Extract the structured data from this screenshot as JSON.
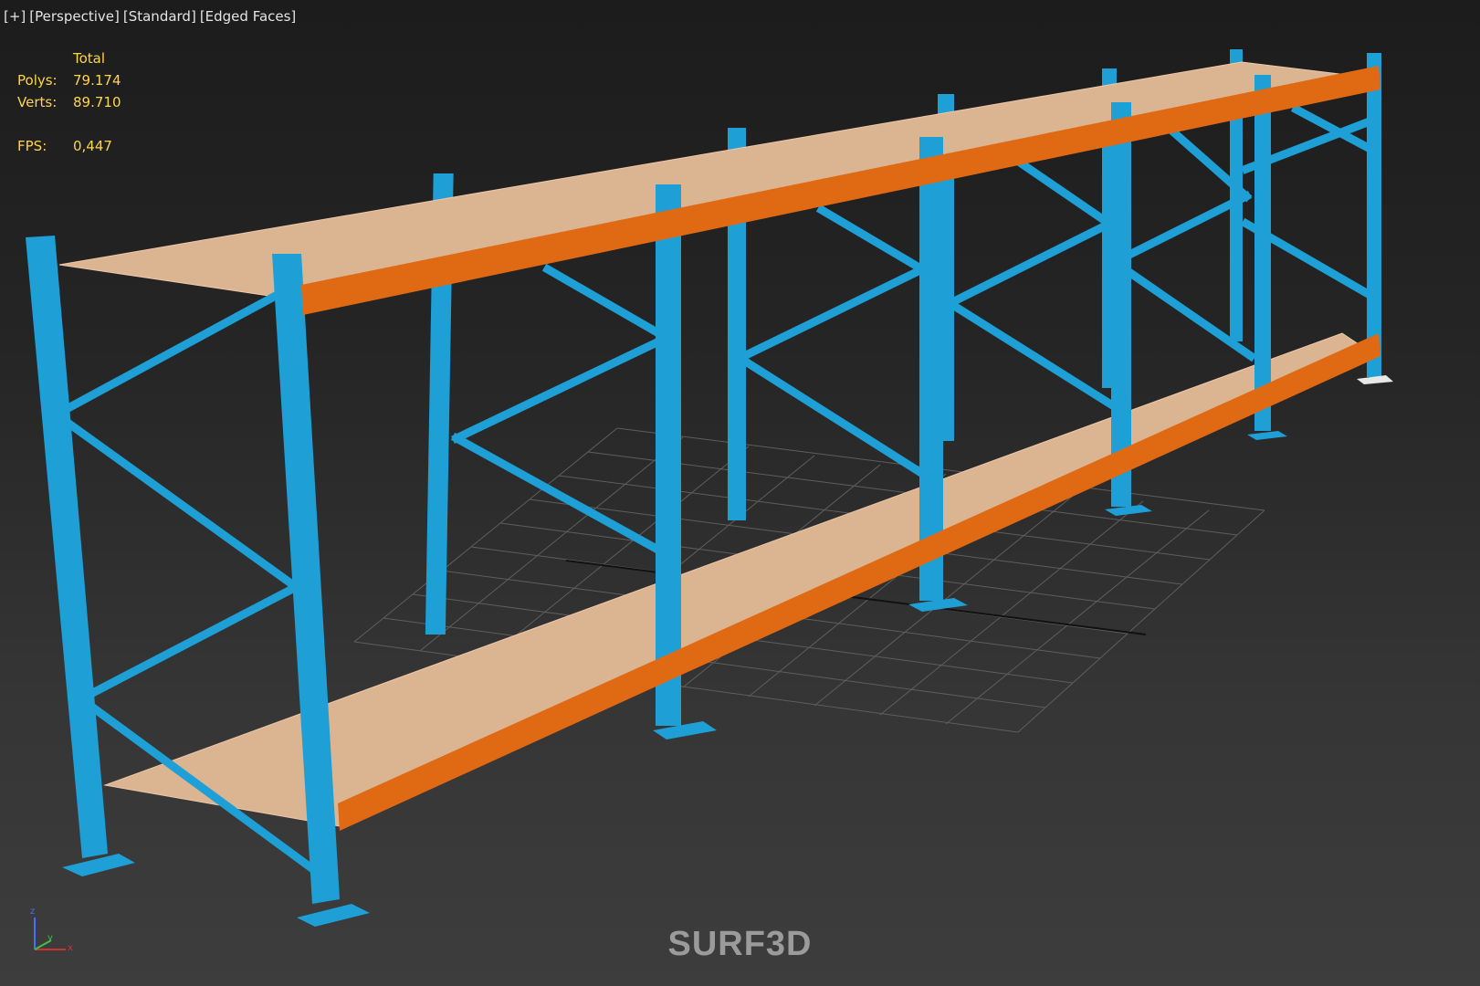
{
  "viewport": {
    "labels": [
      "[+]",
      "[Perspective]",
      "[Standard]",
      "[Edged Faces]"
    ]
  },
  "stats": {
    "header": "Total",
    "polys_label": "Polys:",
    "polys_value": "79.174",
    "verts_label": "Verts:",
    "verts_value": "89.710",
    "fps_label": "FPS:",
    "fps_value": "0,447"
  },
  "watermark": "SURF3D",
  "axis_gizmo": {
    "z": "z",
    "y": "y",
    "x": "x"
  },
  "colors": {
    "upright": "#1e9fd6",
    "upright_dark": "#157fae",
    "beam": "#e06a14",
    "beam_dark": "#b8520c",
    "deck": "#dbb592",
    "grid": "#6a6a6a",
    "background": "#2a2a2a",
    "stats_text": "#ffd54a"
  }
}
